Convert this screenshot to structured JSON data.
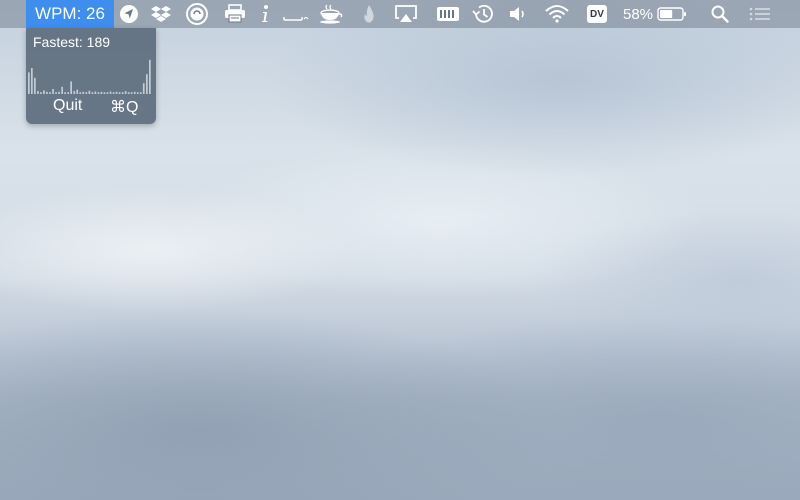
{
  "menubar": {
    "wpm_label": "WPM: 26",
    "accent_color": "#3e8ef0",
    "icons": [
      "navigation-arrow-icon",
      "dropbox-icon",
      "sync-circle-icon",
      "printer-icon",
      "info-icon",
      "whitespace-icon",
      "coffee-cup-icon",
      "flame-icon",
      "airplay-icon",
      "memory-chip-icon",
      "time-machine-icon",
      "volume-icon",
      "wifi-icon",
      "dv-badge-icon",
      "battery-icon",
      "spotlight-search-icon",
      "notification-center-icon"
    ],
    "dv_label": "DV",
    "battery_text": "58%",
    "battery_level": 0.58
  },
  "popup": {
    "fastest_label": "Fastest: 189",
    "quit_label": "Quit",
    "quit_shortcut": "⌘Q",
    "histogram_levels": [
      0.6,
      0.72,
      0.45,
      0.08,
      0.05,
      0.1,
      0.06,
      0.05,
      0.14,
      0.05,
      0.06,
      0.2,
      0.05,
      0.05,
      0.35,
      0.08,
      0.12,
      0.05,
      0.06,
      0.05,
      0.09,
      0.05,
      0.07,
      0.05,
      0.06,
      0.05,
      0.05,
      0.07,
      0.05,
      0.06,
      0.05,
      0.05,
      0.08,
      0.05,
      0.05,
      0.06,
      0.05,
      0.05,
      0.3,
      0.55,
      0.95
    ]
  }
}
